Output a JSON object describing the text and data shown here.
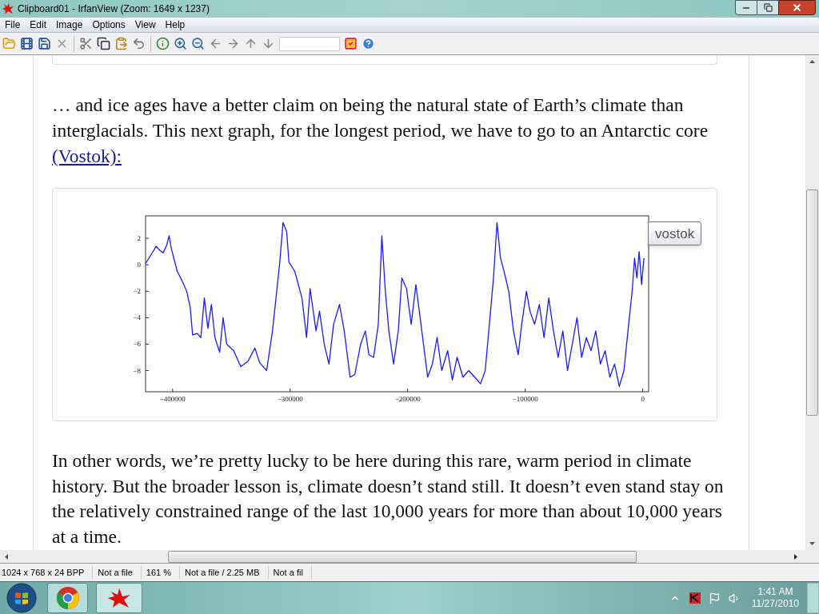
{
  "window": {
    "title": "Clipboard01 - IrfanView (Zoom: 1649 x 1237)"
  },
  "menu": [
    "File",
    "Edit",
    "Image",
    "Options",
    "View",
    "Help"
  ],
  "article": {
    "paragraph_1": "… and ice ages have a better claim on being the natural state of Earth’s climate than interglacials.  This next graph, for the longest period, we have to go to an Antarctic core ",
    "link": "(Vostok):",
    "figure": {
      "chart_data": {
        "type": "line",
        "xlim": [
          -423000,
          5000
        ],
        "ylim": [
          -9.6,
          3.7
        ],
        "xticks": [
          {
            "value": -400000,
            "label": "−400000"
          },
          {
            "value": -300000,
            "label": "−300000"
          },
          {
            "value": -200000,
            "label": "−200000"
          },
          {
            "value": -100000,
            "label": "−100000"
          },
          {
            "value": 0,
            "label": "0"
          }
        ],
        "yticks": [
          {
            "value": 2,
            "label": "2"
          },
          {
            "value": 0,
            "label": "0"
          },
          {
            "value": -2,
            "label": "−2"
          },
          {
            "value": -4,
            "label": "−4"
          },
          {
            "value": -6,
            "label": "−6"
          },
          {
            "value": -8,
            "label": "−8"
          }
        ],
        "x": [
          -423000,
          -418000,
          -414000,
          -411000,
          -408000,
          -405000,
          -403000,
          -401000,
          -396000,
          -392000,
          -388000,
          -385000,
          -383000,
          -379000,
          -376000,
          -373000,
          -370000,
          -367000,
          -364000,
          -360000,
          -357000,
          -354000,
          -348000,
          -342000,
          -336000,
          -330000,
          -326000,
          -320000,
          -315000,
          -312000,
          -309000,
          -306000,
          -303000,
          -301000,
          -296000,
          -290000,
          -286000,
          -283000,
          -278000,
          -275000,
          -271000,
          -267000,
          -263000,
          -258000,
          -254000,
          -249000,
          -245000,
          -240000,
          -236000,
          -233000,
          -229000,
          -225000,
          -222000,
          -219000,
          -216000,
          -212000,
          -208000,
          -205000,
          -201000,
          -197000,
          -193000,
          -188000,
          -183000,
          -179000,
          -175000,
          -171000,
          -166000,
          -162000,
          -158000,
          -153000,
          -148000,
          -143000,
          -138000,
          -134000,
          -130000,
          -127000,
          -124000,
          -121000,
          -118000,
          -114000,
          -110000,
          -106000,
          -103000,
          -99000,
          -96000,
          -92000,
          -88000,
          -84000,
          -80000,
          -76000,
          -72000,
          -68000,
          -64000,
          -60000,
          -56000,
          -52000,
          -48000,
          -44000,
          -40000,
          -36000,
          -32000,
          -28000,
          -24000,
          -20000,
          -16000,
          -12000,
          -9000,
          -7000,
          -5000,
          -3000,
          -1000,
          1000
        ],
        "series": [
          {
            "name": "vostok",
            "color": "#1a1aff",
            "values": [
              0.1,
              0.8,
              1.4,
              1.1,
              0.9,
              1.5,
              2.2,
              1.2,
              -0.5,
              -1.2,
              -2.0,
              -3.2,
              -5.3,
              -5.2,
              -5.5,
              -2.5,
              -4.8,
              -3.0,
              -5.5,
              -6.6,
              -4.0,
              -6.0,
              -6.5,
              -7.7,
              -7.3,
              -6.3,
              -7.4,
              -8.0,
              -5.0,
              -2.5,
              0.0,
              3.2,
              2.5,
              0.2,
              -0.5,
              -2.5,
              -5.5,
              -1.8,
              -5.0,
              -3.5,
              -6.0,
              -7.5,
              -4.5,
              -3.0,
              -5.0,
              -8.5,
              -8.3,
              -6.0,
              -5.0,
              -6.8,
              -7.0,
              -4.5,
              2.2,
              -2.0,
              -5.0,
              -7.5,
              -5.0,
              -1.0,
              -1.8,
              -4.5,
              -1.5,
              -5.0,
              -8.5,
              -7.5,
              -5.5,
              -8.0,
              -6.5,
              -8.7,
              -7.0,
              -8.5,
              -8.0,
              -8.5,
              -9.0,
              -8.0,
              -4.0,
              -1.0,
              3.2,
              0.5,
              -0.5,
              -2.0,
              -5.0,
              -6.8,
              -4.5,
              -2.0,
              -3.5,
              -4.5,
              -3.0,
              -5.5,
              -2.5,
              -5.0,
              -7.0,
              -5.0,
              -8.0,
              -6.0,
              -4.0,
              -7.0,
              -5.5,
              -6.5,
              -5.0,
              -7.5,
              -6.5,
              -8.5,
              -7.5,
              -9.2,
              -8.0,
              -4.5,
              -2.0,
              0.5,
              -1.0,
              1.0,
              -1.5,
              0.5
            ]
          }
        ]
      }
    },
    "paragraph_2": "In other words, we’re pretty lucky to be here during this rare, warm period in climate history.  But the broader lesson is, climate doesn’t stand still.  It doesn’t even stand stay on the relatively constrained range of the last 10,000 years for more than about 10,000 years at a time."
  },
  "status_bar": [
    "1024 x 768 x 24 BPP",
    "Not a file",
    "161 %",
    "Not a file / 2.25 MB",
    "Not a fil"
  ],
  "taskbar": {
    "time": "1:41 AM",
    "date": "11/27/2010"
  }
}
